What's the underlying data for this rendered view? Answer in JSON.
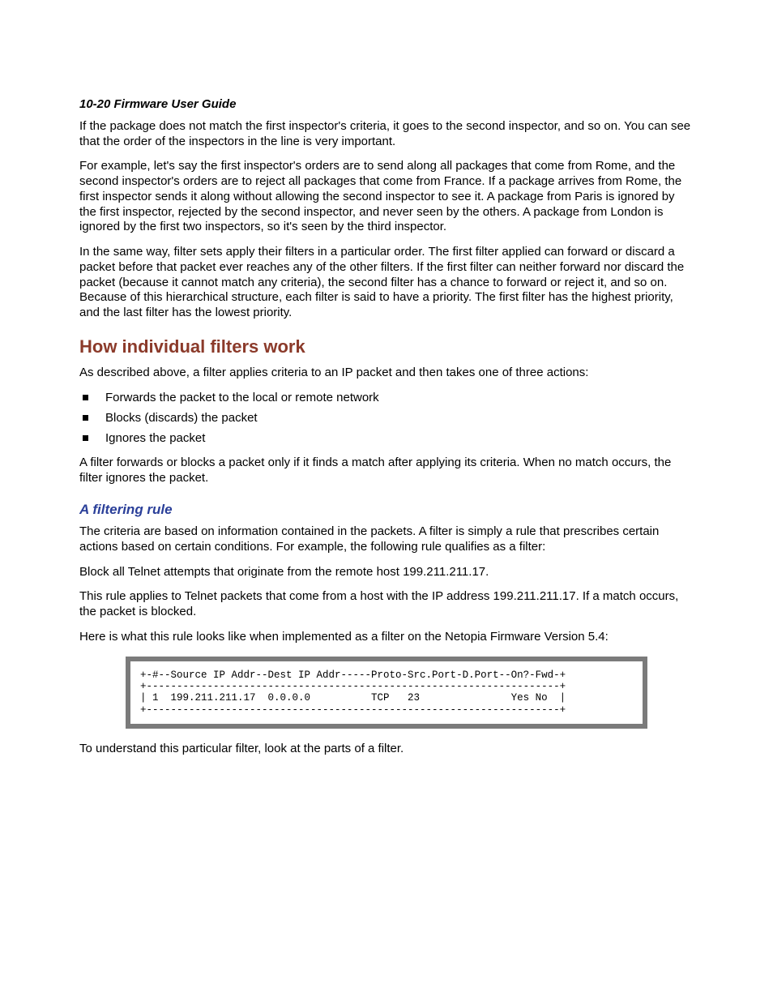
{
  "header": "10-20  Firmware User Guide",
  "p1": "If the package does not match the first inspector's criteria, it goes to the second inspector, and so on. You can see that the order of the inspectors in the line is very important.",
  "p2": "For example, let's say the first inspector's orders are to send along all packages that come from Rome, and the second inspector's orders are to reject all packages that come from France. If a package arrives from Rome, the first inspector sends it along without allowing the second inspector to see it. A package from Paris is ignored by the first inspector, rejected by the second inspector, and never seen by the others. A package from London is ignored by the first two inspectors, so it's seen by the third inspector.",
  "p3": "In the same way, filter sets apply their filters in a particular order. The first filter applied can forward or discard a packet before that packet ever reaches any of the other filters. If the first filter can neither forward nor discard the packet (because it cannot match any criteria), the second filter has a chance to forward or reject it, and so on. Because of this hierarchical structure, each filter is said to have a priority. The first filter has the highest priority, and the last filter has the lowest priority.",
  "h1": "How individual filters work",
  "p4": "As described above, a filter applies criteria to an IP packet and then takes one of three actions:",
  "bullets": {
    "b1": "Forwards the packet to the local or remote network",
    "b2": "Blocks (discards) the packet",
    "b3": "Ignores the packet"
  },
  "p5": "A filter forwards or blocks a packet only if it finds a match after applying its criteria. When no match occurs, the filter ignores the packet.",
  "h2": "A filtering rule",
  "p6": "The criteria are based on information contained in the packets. A filter is simply a rule that prescribes certain actions based on certain conditions. For example, the following rule qualifies as a filter:",
  "p7": "Block all Telnet attempts that originate from the remote host 199.211.211.17.",
  "p8": "This rule applies to Telnet packets that come from a host with the IP address 199.211.211.17. If a match occurs, the packet is blocked.",
  "p9": "Here is what this rule looks like when implemented as a filter on the Netopia Firmware Version 5.4:",
  "terminal": "+-#--Source IP Addr--Dest IP Addr-----Proto-Src.Port-D.Port--On?-Fwd-+\n+--------------------------------------------------------------------+\n| 1  199.211.211.17  0.0.0.0          TCP   23               Yes No  |\n+--------------------------------------------------------------------+",
  "p10": "To understand this particular filter, look at the parts of a filter."
}
